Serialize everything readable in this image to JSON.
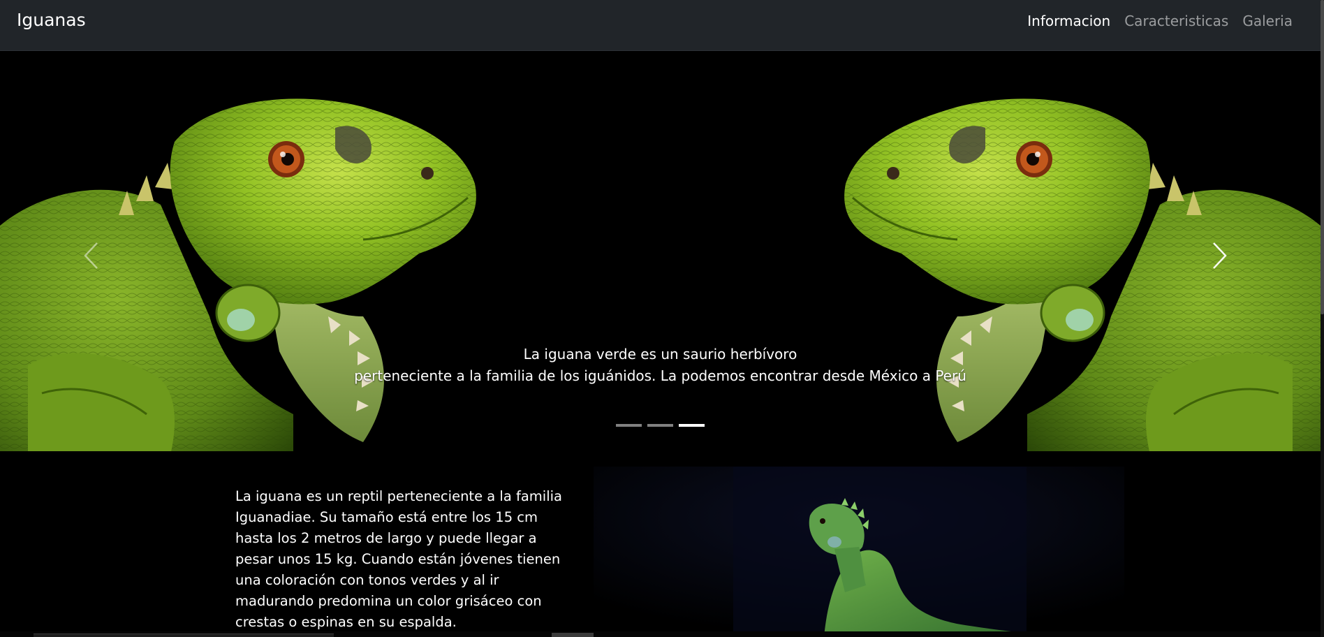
{
  "navbar": {
    "brand": "Iguanas",
    "links": [
      {
        "label": "Informacion",
        "active": true
      },
      {
        "label": "Caracteristicas",
        "active": false
      },
      {
        "label": "Galeria",
        "active": false
      }
    ]
  },
  "carousel": {
    "caption_line1": "La iguana verde es un saurio herbívoro",
    "caption_line2": "perteneciente a la familia de los iguánidos. La podemos encontrar desde México a Perú",
    "indicators": [
      false,
      false,
      true
    ],
    "prev_icon": "chevron-left-icon",
    "next_icon": "chevron-right-icon"
  },
  "info": {
    "paragraph": "La iguana es un reptil perteneciente a la familia Iguanadiae. Su tamaño está entre los 15 cm hasta los 2 metros de largo y puede llegar a pesar unos 15 kg. Cuando están jóvenes tienen una coloración con tonos verdes y al ir madurando predomina un color grisáceo con crestas o espinas en su espalda."
  },
  "colors": {
    "navbar_bg": "#212529",
    "page_bg": "#000000",
    "iguana_green": "#8fbf1e"
  }
}
